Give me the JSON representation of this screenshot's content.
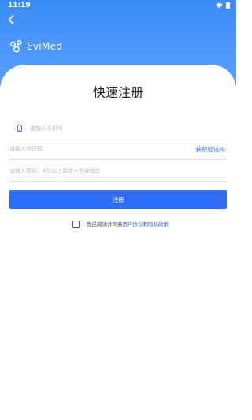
{
  "status_bar": {
    "time": "11:19"
  },
  "header": {
    "back_icon": "chevron-left-icon",
    "brand_name": "EviMed"
  },
  "page": {
    "title": "快速注册"
  },
  "form": {
    "phone_placeholder": "请输入手机号",
    "code_placeholder": "请输入验证码",
    "get_code_label": "获取验证码",
    "password_placeholder": "请输入密码：6位以上数字+字母组合",
    "submit_label": "注册"
  },
  "agreement": {
    "checked": false,
    "prefix": "我已阅读并同意",
    "user_agreement": "用户协议",
    "conjunction": "和",
    "privacy_policy": "隐私政策"
  },
  "colors": {
    "header_blue": "#3b8cf7",
    "accent": "#2d6cf3",
    "divider": "#e3e3e3",
    "placeholder": "#b8b8b8"
  }
}
